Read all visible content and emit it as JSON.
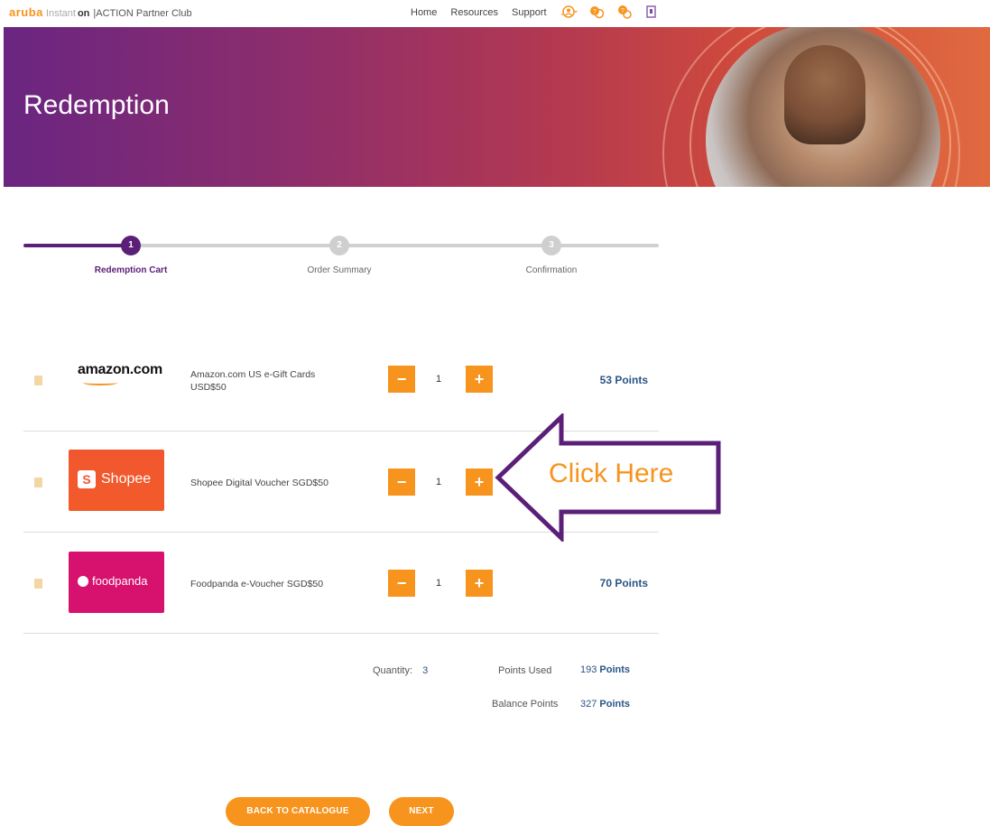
{
  "topnav": {
    "brand_aruba": "aruba",
    "brand_instant": "Instant",
    "brand_on": "on",
    "brand_club": "|ACTION Partner Club",
    "home": "Home",
    "resources": "Resources",
    "support": "Support",
    "icons": [
      "user-icon",
      "help-icon",
      "rewards-icon",
      "logout-icon"
    ]
  },
  "hero": {
    "title": "Redemption"
  },
  "stepper": {
    "steps": [
      {
        "number": "1",
        "label": "Redemption Cart",
        "active": true
      },
      {
        "number": "2",
        "label": "Order Summary",
        "active": false
      },
      {
        "number": "3",
        "label": "Confirmation",
        "active": false
      }
    ]
  },
  "cart": {
    "items": [
      {
        "logo": "amazon",
        "logo_text": "amazon.com",
        "name": "Amazon.com US e-Gift Cards USD$50",
        "quantity": "1",
        "minus": "−",
        "plus": "+",
        "points": "53 Points"
      },
      {
        "logo": "shopee",
        "logo_text": "Shopee",
        "logo_icon": "S",
        "name": "Shopee Digital Voucher SGD$50",
        "quantity": "1",
        "minus": "−",
        "plus": "+",
        "points": ""
      },
      {
        "logo": "foodpanda",
        "logo_text": "foodpanda",
        "name": "Foodpanda e-Voucher SGD$50",
        "quantity": "1",
        "minus": "−",
        "plus": "+",
        "points": "70 Points"
      }
    ]
  },
  "totals": {
    "quantity_label": "Quantity:",
    "quantity_value": "3",
    "points_used_label": "Points Used",
    "points_used_value": "193",
    "points_used_unit": "Points",
    "balance_label": "Balance Points",
    "balance_value": "327",
    "balance_unit": "Points"
  },
  "buttons": {
    "back": "BACK TO CATALOGUE",
    "next": "NEXT"
  },
  "callout": {
    "text": "Click Here",
    "color": "#f7941d",
    "border_color": "#5b1f78"
  },
  "colors": {
    "accent": "#f7941d",
    "brand_purple": "#5b1f78",
    "points_blue": "#2a5486"
  }
}
